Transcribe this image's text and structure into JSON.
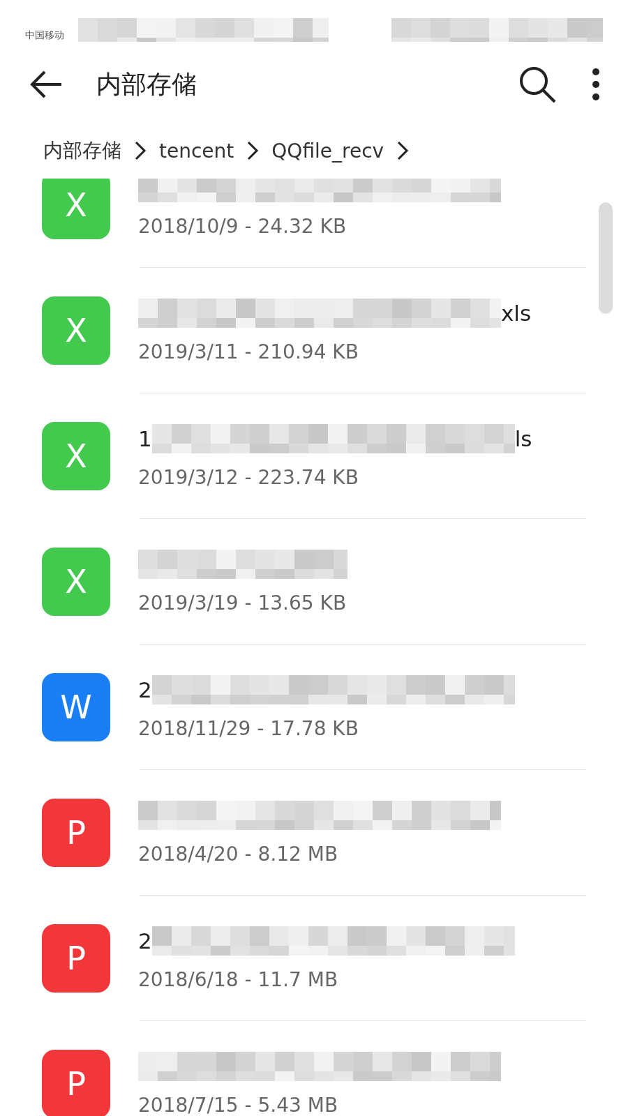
{
  "status_bar": {
    "carrier": "中国移动"
  },
  "header": {
    "title": "内部存储"
  },
  "breadcrumb": [
    "内部存储",
    "tencent",
    "QQfile_recv"
  ],
  "files": [
    {
      "kind": "xls",
      "letter": "X",
      "color": "#43c94e",
      "meta": "2018/10/9 - 24.32 KB"
    },
    {
      "kind": "xls",
      "letter": "X",
      "color": "#43c94e",
      "name_end": "xls",
      "meta": "2019/3/11 - 210.94 KB"
    },
    {
      "kind": "xls",
      "letter": "X",
      "color": "#43c94e",
      "name_start": "1",
      "name_end": "ls",
      "meta": "2019/3/12 - 223.74 KB"
    },
    {
      "kind": "xls",
      "letter": "X",
      "color": "#43c94e",
      "meta": "2019/3/19 - 13.65 KB"
    },
    {
      "kind": "doc",
      "letter": "W",
      "color": "#1a7ff5",
      "name_start": "2",
      "meta": "2018/11/29 - 17.78 KB"
    },
    {
      "kind": "ppt",
      "letter": "P",
      "color": "#f2373b",
      "meta": "2018/4/20 - 8.12 MB"
    },
    {
      "kind": "ppt",
      "letter": "P",
      "color": "#f2373b",
      "name_start": "2",
      "meta": "2018/6/18 - 11.7 MB"
    },
    {
      "kind": "ppt",
      "letter": "P",
      "color": "#f2373b",
      "meta": "2018/7/15 - 5.43 MB"
    }
  ]
}
